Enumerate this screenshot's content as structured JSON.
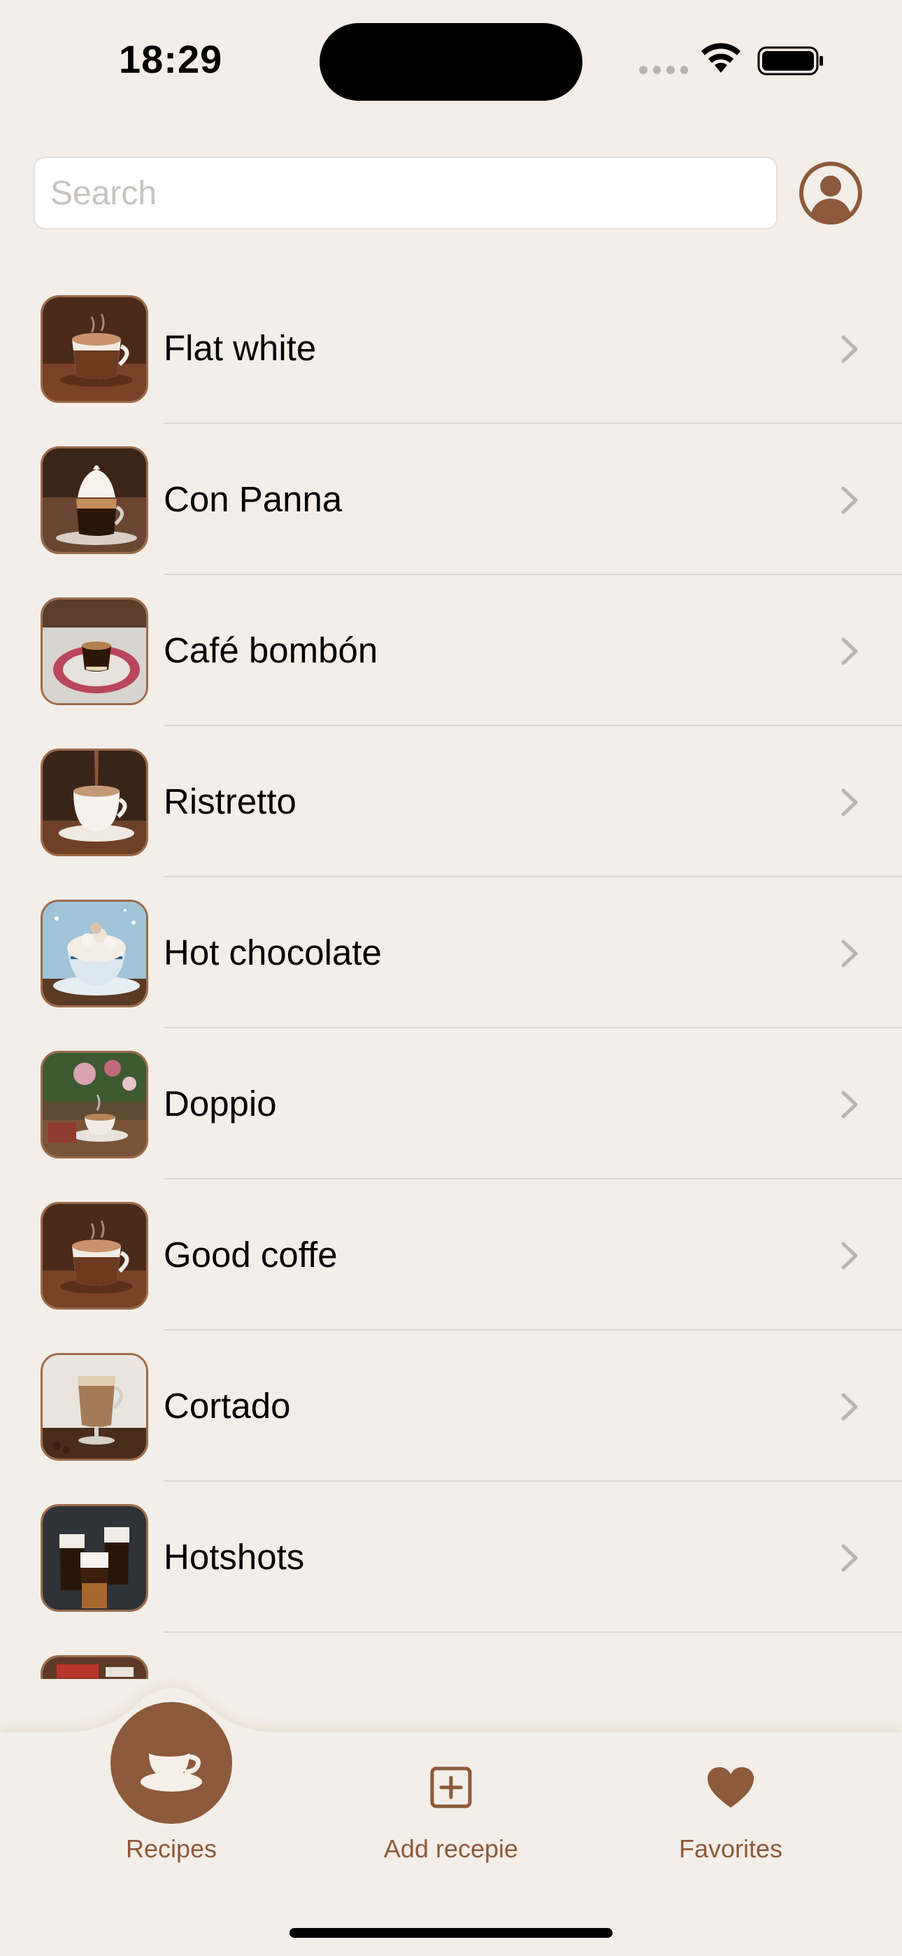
{
  "status_bar": {
    "time": "18:29"
  },
  "search": {
    "placeholder": "Search",
    "value": ""
  },
  "recipes": [
    {
      "name": "Flat white",
      "thumb": "latte-with-cinnamon"
    },
    {
      "name": "Con Panna",
      "thumb": "espresso-whipped-cream"
    },
    {
      "name": "Café bombón",
      "thumb": "espresso-on-saucer"
    },
    {
      "name": "Ristretto",
      "thumb": "white-cup-pouring"
    },
    {
      "name": "Hot chocolate",
      "thumb": "cocoa-marshmallows"
    },
    {
      "name": "Doppio",
      "thumb": "cup-with-flowers"
    },
    {
      "name": "Good coffe",
      "thumb": "latte-with-cinnamon"
    },
    {
      "name": "Cortado",
      "thumb": "glass-cortado"
    },
    {
      "name": "Hotshots",
      "thumb": "layered-shots"
    }
  ],
  "tabs": {
    "recipes": "Recipes",
    "add_recipe": "Add recepie",
    "favorites": "Favorites",
    "active": "recipes"
  },
  "colors": {
    "background": "#f3eee8",
    "accent": "#8d5a3b",
    "divider": "#dcd7d1"
  },
  "icons": {
    "profile": "person-circle-icon",
    "recipes_tab": "coffee-cup-icon",
    "add_tab": "plus-square-icon",
    "favorites_tab": "heart-icon",
    "row_chevron": "chevron-right-icon"
  }
}
